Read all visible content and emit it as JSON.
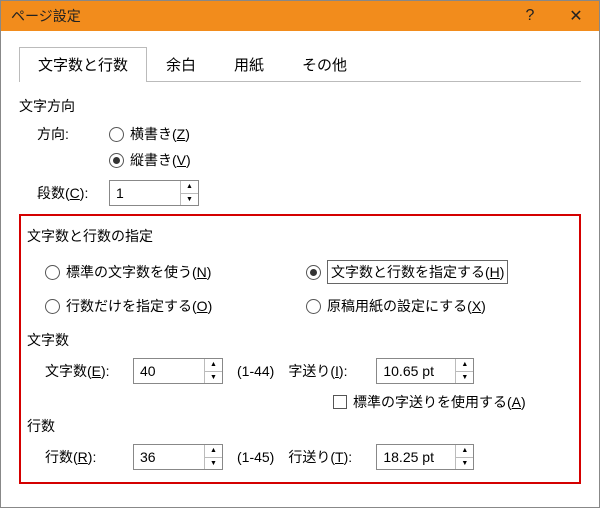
{
  "window": {
    "title": "ページ設定"
  },
  "tabs": [
    {
      "label": "文字数と行数",
      "active": true
    },
    {
      "label": "余白",
      "active": false
    },
    {
      "label": "用紙",
      "active": false
    },
    {
      "label": "その他",
      "active": false
    }
  ],
  "text_direction": {
    "section_label": "文字方向",
    "direction_label": "方向:",
    "horizontal": {
      "pre": "横書き(",
      "key": "Z",
      "post": ")",
      "checked": false
    },
    "vertical": {
      "pre": "縦書き(",
      "key": "V",
      "post": ")",
      "checked": true
    },
    "columns_label_pre": "段数(",
    "columns_label_key": "C",
    "columns_label_post": "):",
    "columns_value": "1"
  },
  "spec": {
    "section_label": "文字数と行数の指定",
    "options": {
      "standard": {
        "pre": "標準の文字数を使う(",
        "key": "N",
        "post": ")",
        "checked": false
      },
      "specify_both": {
        "pre": "文字数と行数を指定する(",
        "key": "H",
        "post": ")",
        "checked": true
      },
      "lines_only": {
        "pre": "行数だけを指定する(",
        "key": "O",
        "post": ")",
        "checked": false
      },
      "manuscript": {
        "pre": "原稿用紙の設定にする(",
        "key": "X",
        "post": ")",
        "checked": false
      }
    }
  },
  "chars": {
    "section_label": "文字数",
    "count_label_pre": "文字数(",
    "count_label_key": "E",
    "count_label_post": "):",
    "count_value": "40",
    "count_range": "(1-44)",
    "pitch_label_pre": "字送り(",
    "pitch_label_key": "I",
    "pitch_label_post": "):",
    "pitch_value": "10.65 pt",
    "use_std_pitch_pre": "標準の字送りを使用する(",
    "use_std_pitch_key": "A",
    "use_std_pitch_post": ")"
  },
  "lines": {
    "section_label": "行数",
    "count_label_pre": "行数(",
    "count_label_key": "R",
    "count_label_post": "):",
    "count_value": "36",
    "count_range": "(1-45)",
    "pitch_label_pre": "行送り(",
    "pitch_label_key": "T",
    "pitch_label_post": "):",
    "pitch_value": "18.25 pt"
  }
}
